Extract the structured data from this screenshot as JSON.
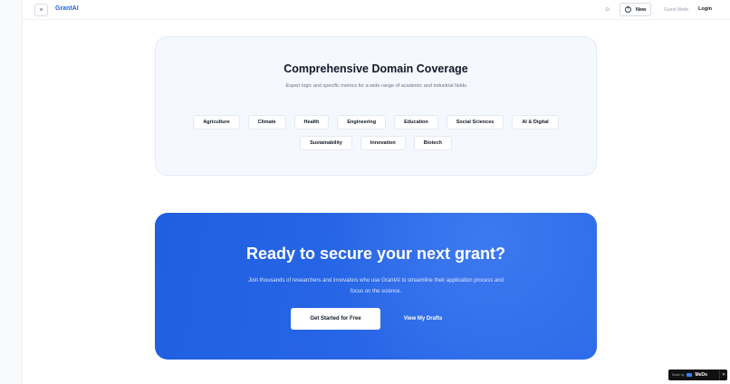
{
  "header": {
    "brand": "GrantAI",
    "menu_icon": "≡",
    "theme_icon": "sun-icon",
    "new_label": "New",
    "guest_label": "Guest Mode",
    "login_label": "Login"
  },
  "domain": {
    "title": "Comprehensive Domain Coverage",
    "subtitle": "Expert logic and specific metrics for a wide range of academic and industrial fields.",
    "chips_row1": [
      "Agriculture",
      "Climate",
      "Health",
      "Engineering",
      "Education",
      "Social Sciences",
      "AI & Digital"
    ],
    "chips_row2": [
      "Sustainability",
      "Innovation",
      "Biotech"
    ]
  },
  "cta": {
    "title": "Ready to secure your next grant?",
    "subtitle": "Join thousands of researchers and innovators who use GrantAI to streamline their application process and focus on the science.",
    "primary_label": "Get Started for Free",
    "secondary_label": "View My Drafts"
  },
  "badge": {
    "prefix": "Made by",
    "name": "MeDo",
    "close": "✕"
  },
  "colors": {
    "accent": "#2563eb",
    "cta_background": "#2563eb",
    "domain_card_background": "#f5f8ff"
  }
}
